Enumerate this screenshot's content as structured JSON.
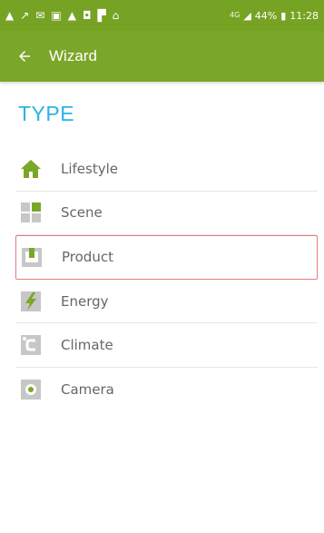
{
  "status_bar": {
    "icons": [
      "warning-icon",
      "missed-call-icon",
      "mail-icon",
      "image-icon",
      "warning-icon",
      "photo-icon",
      "flipboard-icon",
      "lock-icon"
    ],
    "network": "4G",
    "battery": "44%",
    "time": "11:28"
  },
  "app_bar": {
    "back_icon": "arrow-left-icon",
    "title": "Wizard"
  },
  "section": {
    "title": "TYPE"
  },
  "types": [
    {
      "label": "Lifestyle",
      "icon": "house-icon",
      "color": "#7aa629",
      "selected": false
    },
    {
      "label": "Scene",
      "icon": "grid-icon",
      "color": "#c7c7c7",
      "selected": false
    },
    {
      "label": "Product",
      "icon": "product-box-icon",
      "color": "#c7c7c7",
      "selected": true
    },
    {
      "label": "Energy",
      "icon": "lightning-icon",
      "color": "#c7c7c7",
      "selected": false
    },
    {
      "label": "Climate",
      "icon": "climate-icon",
      "color": "#c7c7c7",
      "selected": false
    },
    {
      "label": "Camera",
      "icon": "camera-icon",
      "color": "#c7c7c7",
      "selected": false
    }
  ],
  "colors": {
    "accent": "#7aa629",
    "title_blue": "#2bb3e5",
    "selection_border": "#e57a84"
  }
}
